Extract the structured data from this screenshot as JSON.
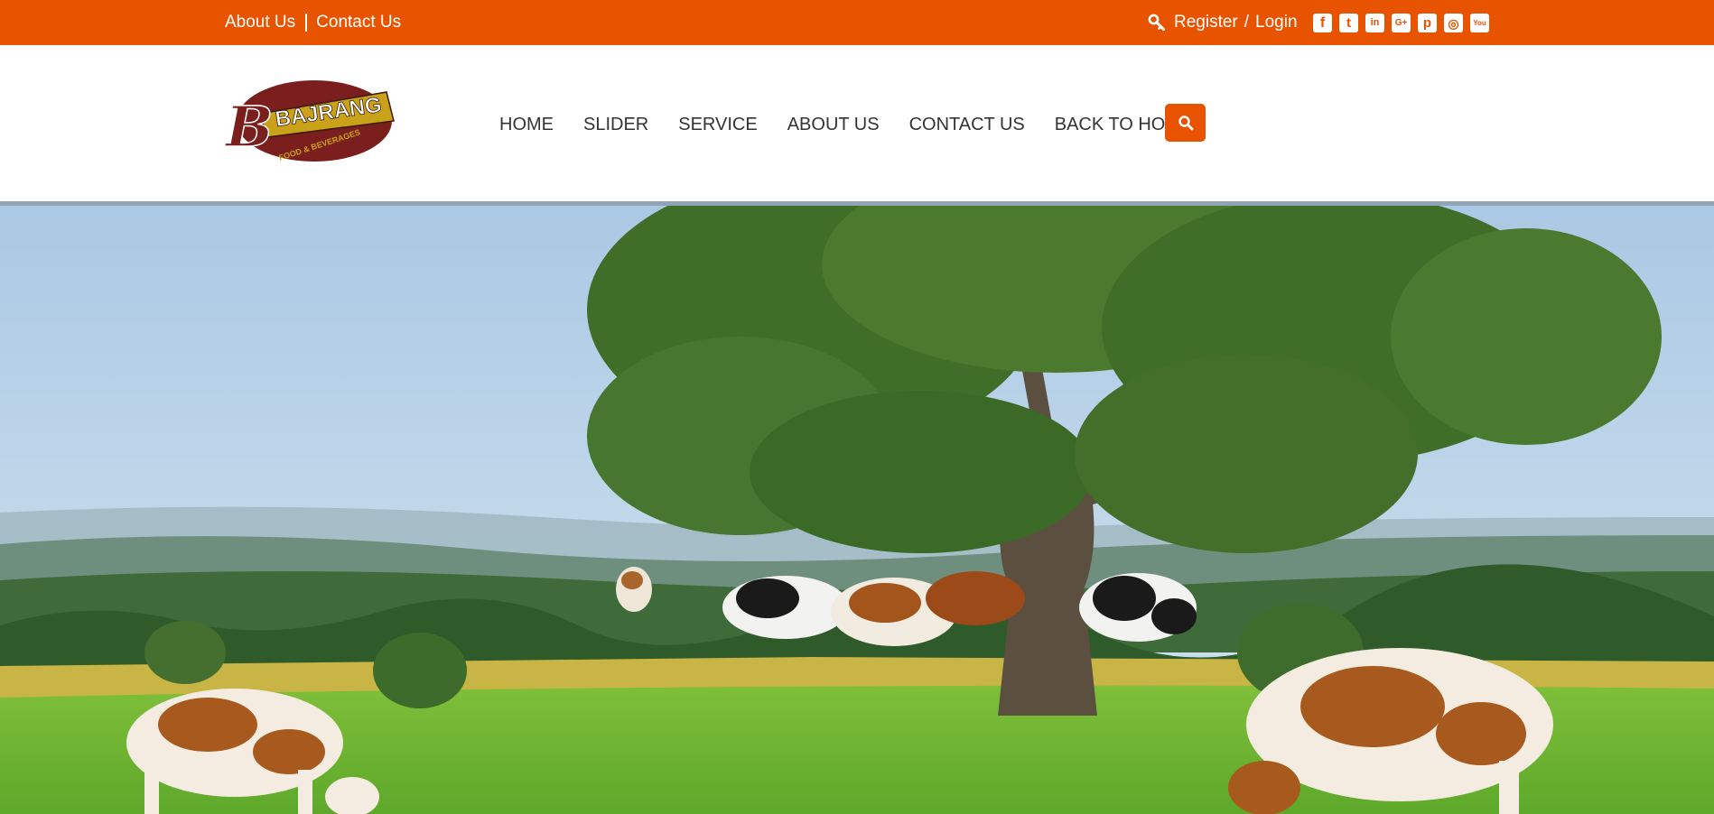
{
  "topbar": {
    "links": [
      "About Us",
      "Contact Us"
    ],
    "register": "Register",
    "separator": "/",
    "login": "Login",
    "social_icons": [
      "facebook-icon",
      "twitter-icon",
      "linkedin-icon",
      "google-plus-icon",
      "pinterest-icon",
      "instagram-icon",
      "youtube-icon"
    ],
    "social_glyphs": [
      "f",
      "t",
      "in",
      "G+",
      "p",
      "◎",
      "You"
    ]
  },
  "logo": {
    "brand": "BAJRANG",
    "tagline": "FOOD & BEVERAGES",
    "initial": "B"
  },
  "nav": [
    "HOME",
    "SLIDER",
    "SERVICE",
    "ABOUT US",
    "CONTACT US",
    "BACK TO HOME"
  ],
  "search": {
    "icon": "search-icon"
  },
  "colors": {
    "accent": "#E85300",
    "nav_text": "#333333",
    "logo_maroon": "#7A1E1E",
    "logo_gold": "#C9A21A"
  }
}
